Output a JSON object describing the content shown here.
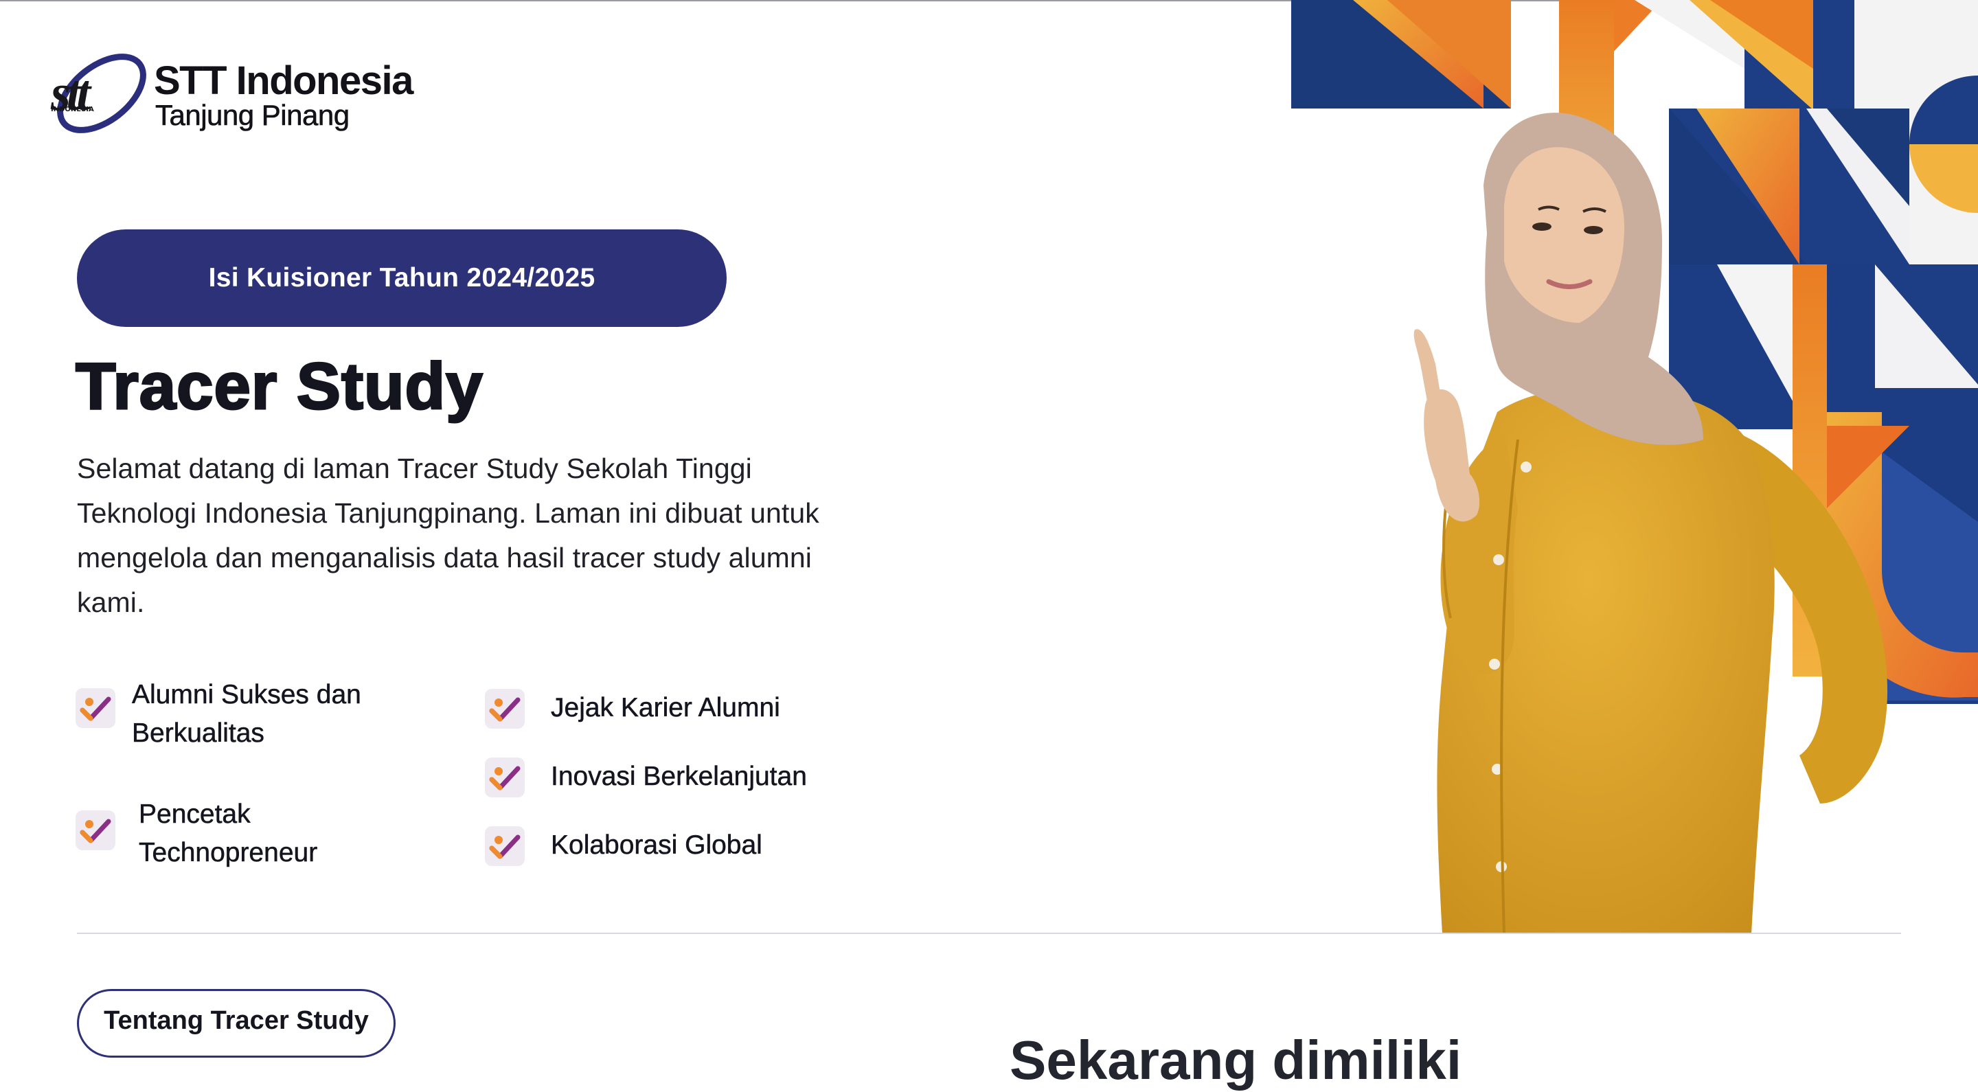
{
  "brand": {
    "name": "STT Indonesia",
    "location": "Tanjung Pinang",
    "logo_text": "stt",
    "logo_small": "INDONESIA"
  },
  "hero": {
    "cta_label": "Isi Kuisioner Tahun 2024/2025",
    "title": "Tracer Study",
    "description": "Selamat datang di laman Tracer Study Sekolah Tinggi Teknologi Indonesia Tanjungpinang. Laman ini dibuat untuk mengelola dan menganalisis data hasil tracer study alumni kami.",
    "features": [
      {
        "label": "Alumni Sukses dan Berkualitas",
        "icon": "check-badge-icon"
      },
      {
        "label": "Pencetak Technopreneur",
        "icon": "check-badge-icon"
      },
      {
        "label": "Jejak Karier Alumni",
        "icon": "check-badge-icon"
      },
      {
        "label": "Inovasi Berkelanjutan",
        "icon": "check-badge-icon"
      },
      {
        "label": "Kolaborasi Global",
        "icon": "check-badge-icon"
      }
    ]
  },
  "about": {
    "button_label": "Tentang Tracer Study",
    "heading": "Sekarang dimiliki"
  },
  "colors": {
    "primary": "#2d3177",
    "navy": "#1e3f86",
    "orange": "#ea7d24",
    "yellow": "#f0b13c",
    "mustard": "#e0a42a",
    "check_purple": "#8b2f86",
    "check_bg": "#efeaf2"
  }
}
